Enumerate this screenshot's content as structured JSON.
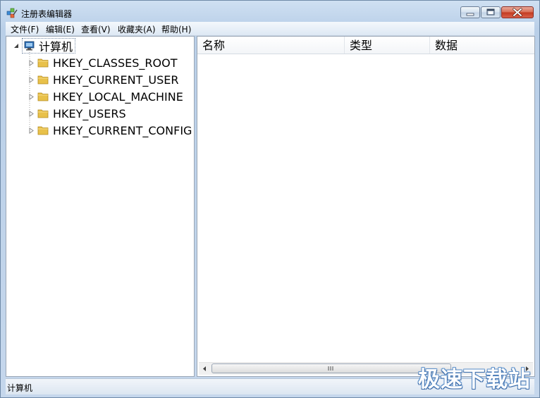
{
  "window": {
    "title": "注册表编辑器"
  },
  "menu": [
    "文件(F)",
    "编辑(E)",
    "查看(V)",
    "收藏夹(A)",
    "帮助(H)"
  ],
  "tree": {
    "root": "计算机",
    "children": [
      "HKEY_CLASSES_ROOT",
      "HKEY_CURRENT_USER",
      "HKEY_LOCAL_MACHINE",
      "HKEY_USERS",
      "HKEY_CURRENT_CONFIG"
    ]
  },
  "list": {
    "columns": [
      "名称",
      "类型",
      "数据"
    ]
  },
  "status": {
    "path": "计算机"
  },
  "watermark": "极速下载站",
  "colors": {
    "title_bg": "#b9cfe8",
    "folder": "#e8c14a",
    "close": "#c2391f"
  },
  "icons": [
    "regedit-icon",
    "computer-icon",
    "folder-icon",
    "minimize-icon",
    "maximize-icon",
    "close-icon"
  ]
}
